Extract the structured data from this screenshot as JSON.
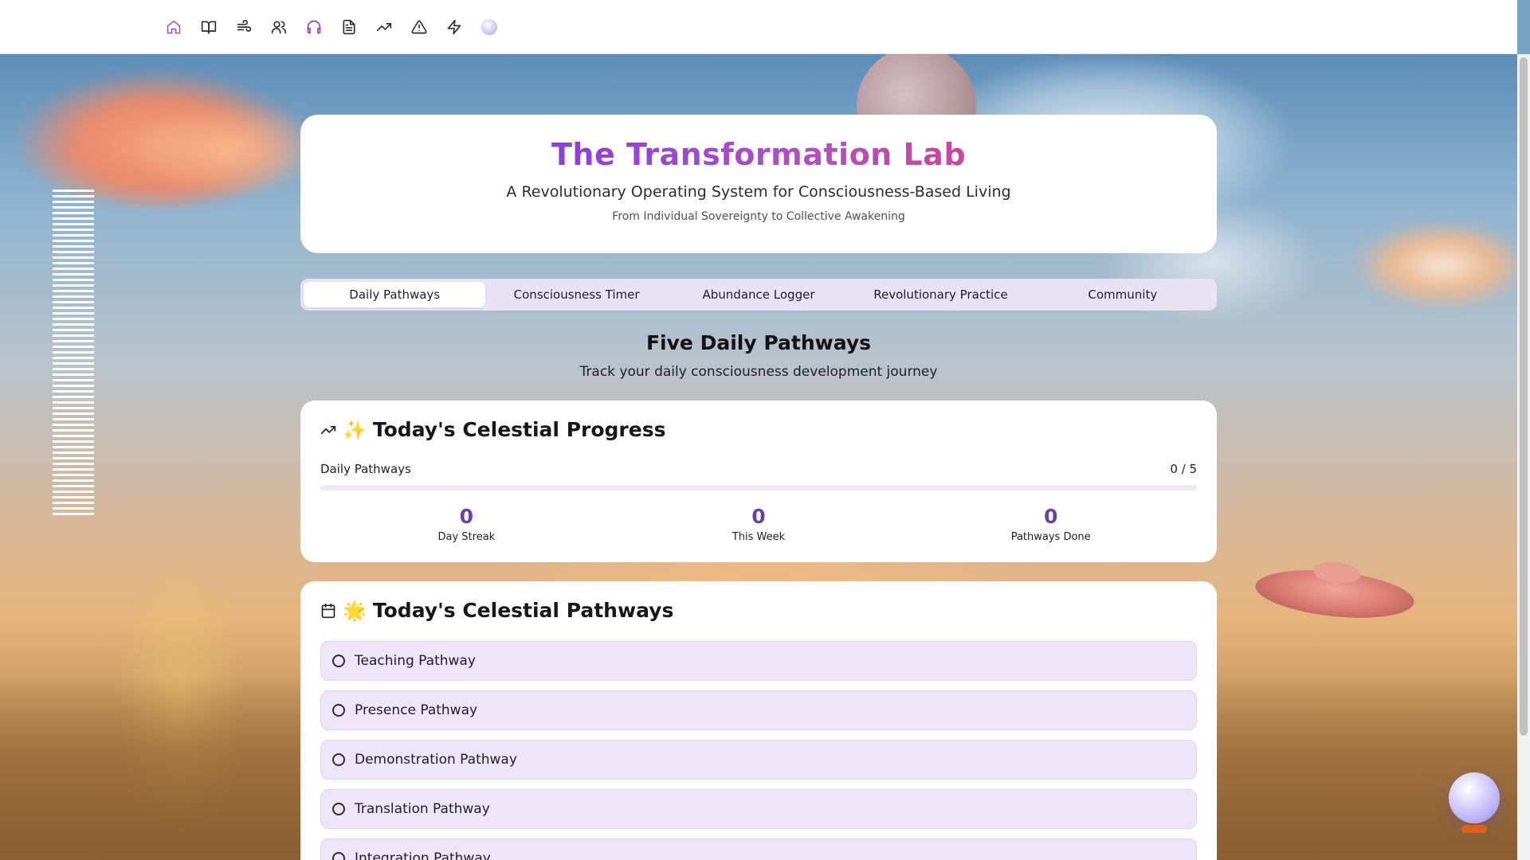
{
  "nav": {
    "items": [
      {
        "name": "home",
        "icon": "home-icon"
      },
      {
        "name": "book",
        "icon": "book-open-icon"
      },
      {
        "name": "wind",
        "icon": "wind-icon"
      },
      {
        "name": "users",
        "icon": "users-icon"
      },
      {
        "name": "music",
        "icon": "headphones-icon"
      },
      {
        "name": "document",
        "icon": "file-text-icon"
      },
      {
        "name": "trends",
        "icon": "trending-up-icon"
      },
      {
        "name": "alert",
        "icon": "alert-triangle-icon"
      },
      {
        "name": "power",
        "icon": "zap-icon"
      },
      {
        "name": "orb",
        "icon": "orb-icon"
      }
    ],
    "active_color": "#9b5ad1"
  },
  "hero": {
    "title": "The Transformation Lab",
    "subtitle": "A Revolutionary Operating System for Consciousness-Based Living",
    "tagline": "From Individual Sovereignty to Collective Awakening"
  },
  "tabs": [
    {
      "label": "Daily Pathways",
      "active": true
    },
    {
      "label": "Consciousness Timer",
      "active": false
    },
    {
      "label": "Abundance Logger",
      "active": false
    },
    {
      "label": "Revolutionary Practice",
      "active": false
    },
    {
      "label": "Community",
      "active": false
    }
  ],
  "section": {
    "title": "Five Daily Pathways",
    "description": "Track your daily consciousness development journey"
  },
  "progress_card": {
    "emoji": "✨",
    "title": "Today's Celestial Progress",
    "label": "Daily Pathways",
    "count_text": "0 / 5",
    "completed": 0,
    "total": 5,
    "stats": [
      {
        "value": "0",
        "label": "Day Streak"
      },
      {
        "value": "0",
        "label": "This Week"
      },
      {
        "value": "0",
        "label": "Pathways Done"
      }
    ]
  },
  "pathways_card": {
    "emoji": "🌟",
    "title": "Today's Celestial Pathways",
    "items": [
      "Teaching Pathway",
      "Presence Pathway",
      "Demonstration Pathway",
      "Translation Pathway",
      "Integration Pathway"
    ]
  },
  "colors": {
    "accent": "#9b5ad1",
    "stat_number": "#6c3fa6",
    "pathway_bg": "#efe5f8",
    "tab_bar_bg": "#e9e1f4"
  }
}
